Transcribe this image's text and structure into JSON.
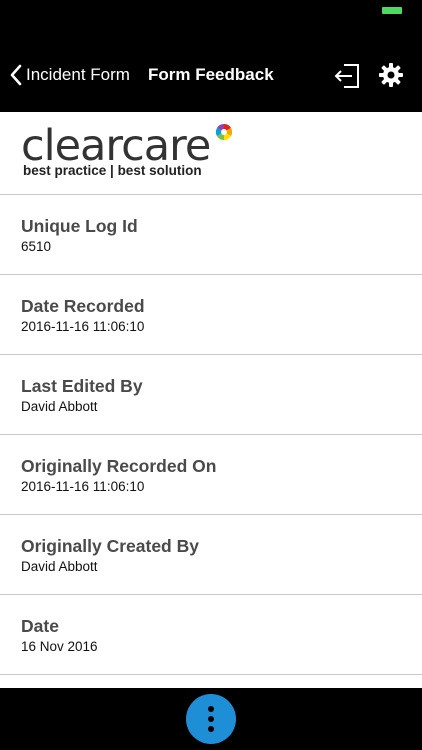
{
  "nav": {
    "back_label": "Incident Form",
    "title": "Form Feedback",
    "logout_icon": "logout-icon",
    "settings_icon": "gear-icon"
  },
  "logo": {
    "word": "clearcare",
    "tagline": "best practice | best solution"
  },
  "rows": [
    {
      "label": "Unique Log Id",
      "value": "6510"
    },
    {
      "label": "Date Recorded",
      "value": "2016-11-16 11:06:10"
    },
    {
      "label": "Last Edited By",
      "value": "David Abbott"
    },
    {
      "label": "Originally Recorded On",
      "value": "2016-11-16 11:06:10"
    },
    {
      "label": "Originally Created By",
      "value": "David Abbott"
    },
    {
      "label": "Date",
      "value": "16 Nov 2016"
    }
  ],
  "colors": {
    "fab": "#1e8fd6",
    "battery": "#4cd964"
  }
}
